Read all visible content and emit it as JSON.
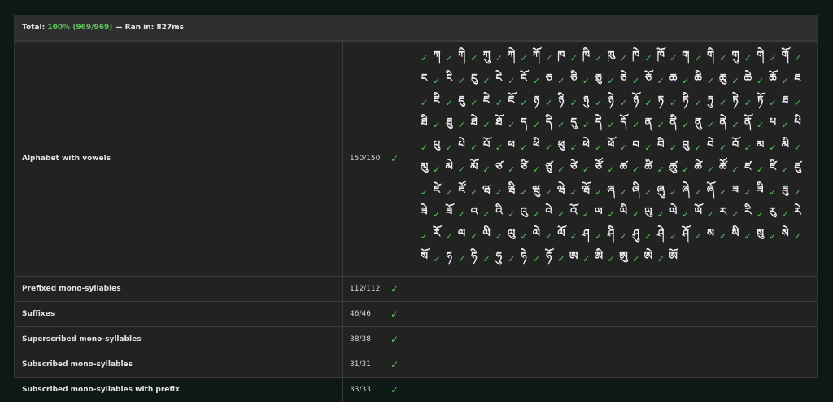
{
  "summary": {
    "total_label": "Total:",
    "percent": "100% (969/969)",
    "ran_label": "— Ran in:",
    "ran_value": "827ms"
  },
  "check_glyph": "✓",
  "rows": [
    {
      "name": "Alphabet with vowels",
      "count": "150/150",
      "glyphs": [
        "ཀ",
        "ཀི",
        "ཀུ",
        "ཀེ",
        "ཀོ",
        "ཁ",
        "ཁི",
        "ཁུ",
        "ཁེ",
        "ཁོ",
        "ག",
        "གི",
        "གུ",
        "གེ",
        "གོ",
        "ང",
        "ངི",
        "ངུ",
        "ངེ",
        "ངོ",
        "ཅ",
        "ཅི",
        "ཅུ",
        "ཅེ",
        "ཅོ",
        "ཆ",
        "ཆི",
        "ཆུ",
        "ཆེ",
        "ཆོ",
        "ཇ",
        "ཇི",
        "ཇུ",
        "ཇེ",
        "ཇོ",
        "ཉ",
        "ཉི",
        "ཉུ",
        "ཉེ",
        "ཉོ",
        "ཏ",
        "ཏི",
        "ཏུ",
        "ཏེ",
        "ཏོ",
        "ཐ",
        "ཐི",
        "ཐུ",
        "ཐེ",
        "ཐོ",
        "ད",
        "དི",
        "དུ",
        "དེ",
        "དོ",
        "ན",
        "ནི",
        "ནུ",
        "ནེ",
        "ནོ",
        "པ",
        "པི",
        "པུ",
        "པེ",
        "པོ",
        "ཕ",
        "ཕི",
        "ཕུ",
        "ཕེ",
        "ཕོ",
        "བ",
        "བི",
        "བུ",
        "བེ",
        "བོ",
        "མ",
        "མི",
        "མུ",
        "མེ",
        "མོ",
        "ཙ",
        "ཙི",
        "ཙུ",
        "ཙེ",
        "ཙོ",
        "ཚ",
        "ཚི",
        "ཚུ",
        "ཚེ",
        "ཚོ",
        "ཛ",
        "ཛི",
        "ཛུ",
        "ཛེ",
        "ཛོ",
        "ཝ",
        "ཝི",
        "ཝུ",
        "ཝེ",
        "ཝོ",
        "ཞ",
        "ཞི",
        "ཞུ",
        "ཞེ",
        "ཞོ",
        "ཟ",
        "ཟི",
        "ཟུ",
        "ཟེ",
        "ཟོ",
        "འ",
        "འི",
        "འུ",
        "འེ",
        "འོ",
        "ཡ",
        "ཡི",
        "ཡུ",
        "ཡེ",
        "ཡོ",
        "ར",
        "རི",
        "རུ",
        "རེ",
        "རོ",
        "ལ",
        "ལི",
        "ལུ",
        "ལེ",
        "ལོ",
        "ཤ",
        "ཤི",
        "ཤུ",
        "ཤེ",
        "ཤོ",
        "ས",
        "སི",
        "སུ",
        "སེ",
        "སོ",
        "ཧ",
        "ཧི",
        "ཧུ",
        "ཧེ",
        "ཧོ",
        "ཨ",
        "ཨི",
        "ཨུ",
        "ཨེ",
        "ཨོ"
      ]
    },
    {
      "name": "Prefixed mono-syllables",
      "count": "112/112"
    },
    {
      "name": "Suffixes",
      "count": "46/46"
    },
    {
      "name": "Superscribed mono-syllables",
      "count": "38/38"
    },
    {
      "name": "Subscribed mono-syllables",
      "count": "31/31"
    },
    {
      "name": "Subscribed mono-syllables with prefix",
      "count": "33/33"
    }
  ]
}
